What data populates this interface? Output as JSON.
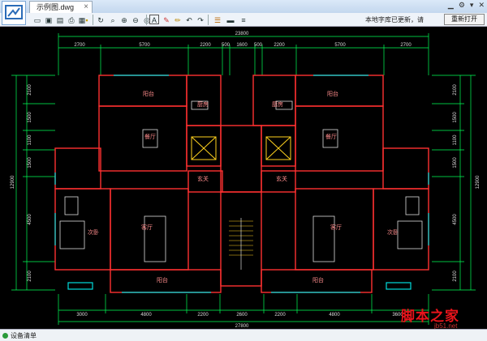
{
  "window": {
    "tab_title": "示例图.dwg",
    "tab_close": "×"
  },
  "toolbar": {
    "notice": "本地字库已更新，请",
    "reopen_label": "重新打开",
    "icons": [
      "folder-open-icon",
      "save-icon",
      "save-as-icon",
      "print-icon",
      "export-icon",
      "lock-icon",
      "rotate-icon",
      "zoom-icon",
      "zoom-in-icon",
      "zoom-out-icon",
      "zoom-extents-icon",
      "text-icon",
      "pen-icon",
      "pencil-icon",
      "undo-icon",
      "redo-icon",
      "cloud-icon",
      "layer-icon",
      "layers-icon"
    ]
  },
  "window_controls": [
    "minimize-icon",
    "settings-icon",
    "dropdown-icon",
    "close-icon"
  ],
  "drawing": {
    "top_total": "23800",
    "top_dims": [
      "2700",
      "5700",
      "2200",
      "500",
      "1600",
      "500",
      "2200",
      "5700",
      "2700"
    ],
    "bottom_total": "27800",
    "bottom_dims": [
      "3000",
      "4800",
      "2200",
      "2600",
      "2200",
      "4800",
      "3600"
    ],
    "left_dims": [
      "2100",
      "1500",
      "1100",
      "1500",
      "4500",
      "2100"
    ],
    "left_total": "12900",
    "right_dims": [
      "2100",
      "1500",
      "1100",
      "1500",
      "4500",
      "2100"
    ],
    "right_total": "12900",
    "room_labels": [
      "阳台",
      "厨房",
      "厨房",
      "阳台",
      "餐厅",
      "餐厅",
      "玄关",
      "玄关",
      "次卧",
      "客厅",
      "阳台",
      "客厅",
      "阳台",
      "次卧"
    ],
    "colors": {
      "wall": "#ff3030",
      "dim": "#00ff55",
      "furniture": "#dddddd",
      "window": "#00dddd",
      "door": "#ffd21e"
    }
  },
  "status": {
    "label": "设备清单"
  },
  "watermark": {
    "main": "脚本之家",
    "sub": "jb51.net"
  }
}
